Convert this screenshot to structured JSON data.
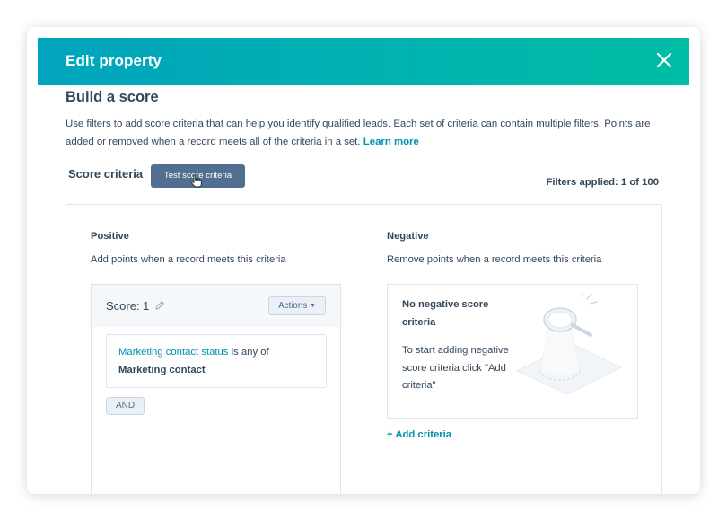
{
  "modal": {
    "title": "Edit property",
    "close_icon": "close-icon"
  },
  "section": {
    "title": "Build a score",
    "intro": "Use filters to add score criteria that can help you identify qualified leads. Each set of criteria can contain multiple filters. Points are added or removed when a record meets all of the criteria in a set.",
    "learn_more": "Learn more"
  },
  "criteria_bar": {
    "label": "Score criteria",
    "test_button": "Test score criteria",
    "filters_applied": "Filters applied: 1 of 100"
  },
  "positive": {
    "title": "Positive",
    "description": "Add points when a record meets this criteria",
    "score_label": "Score: 1",
    "actions_label": "Actions",
    "filter": {
      "property": "Marketing contact status",
      "operator": "is any of",
      "value": "Marketing contact"
    },
    "and_label": "AND"
  },
  "negative": {
    "title": "Negative",
    "description": "Remove points when a record meets this criteria",
    "empty_title": "No negative score criteria",
    "empty_body": "To start adding negative score criteria click \"Add criteria\"",
    "add_criteria": "+ Add criteria"
  },
  "colors": {
    "header_start": "#00a4bd",
    "header_end": "#00bda5",
    "link": "#0091ae",
    "text": "#33475b",
    "button_dark": "#516f90"
  }
}
